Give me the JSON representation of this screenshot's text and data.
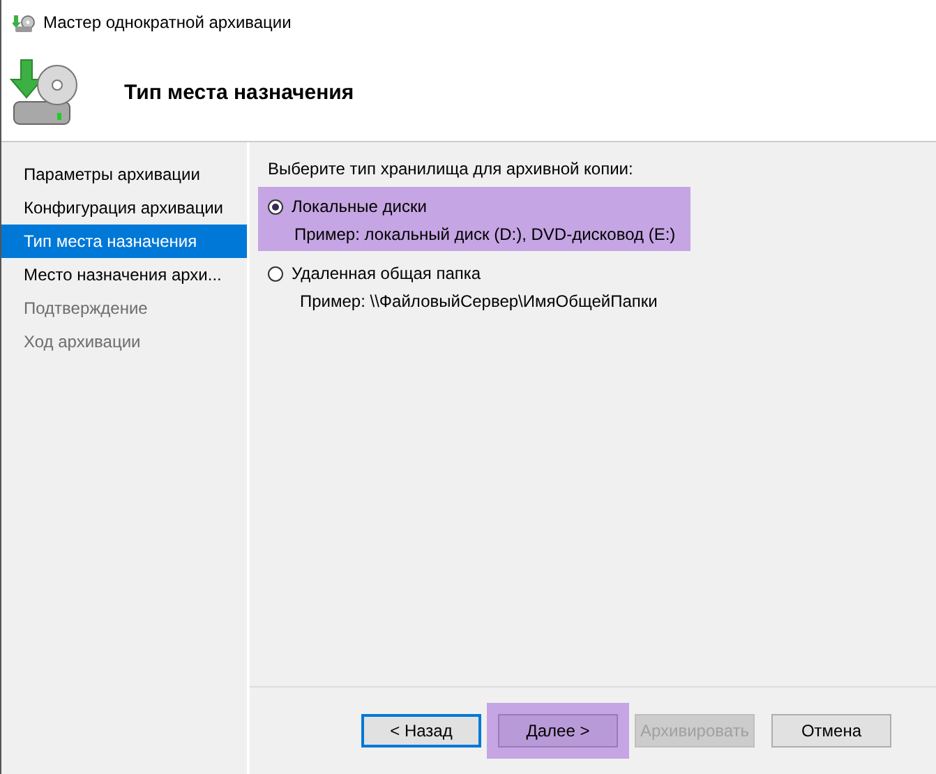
{
  "window": {
    "title": "Мастер однократной архивации"
  },
  "header": {
    "title": "Тип места назначения"
  },
  "sidebar": {
    "items": [
      {
        "label": "Параметры архивации",
        "selected": false,
        "disabled": false
      },
      {
        "label": "Конфигурация архивации",
        "selected": false,
        "disabled": false
      },
      {
        "label": "Тип места назначения",
        "selected": true,
        "disabled": false
      },
      {
        "label": "Место назначения архи...",
        "selected": false,
        "disabled": false
      },
      {
        "label": "Подтверждение",
        "selected": false,
        "disabled": true
      },
      {
        "label": "Ход архивации",
        "selected": false,
        "disabled": true
      }
    ]
  },
  "content": {
    "prompt": "Выберите тип хранилища для архивной копии:",
    "options": [
      {
        "label": "Локальные диски",
        "example": "Пример: локальный диск (D:), DVD-дисковод (E:)",
        "selected": true,
        "highlighted": true
      },
      {
        "label": "Удаленная общая папка",
        "example": "Пример: \\\\ФайловыйСервер\\ИмяОбщейПапки",
        "selected": false,
        "highlighted": false
      }
    ]
  },
  "buttons": [
    {
      "label": "< Назад",
      "focused": true,
      "disabled": false,
      "highlighted": false
    },
    {
      "label": "Далее >",
      "focused": false,
      "disabled": false,
      "highlighted": true
    },
    {
      "label": "Архивировать",
      "focused": false,
      "disabled": true,
      "highlighted": false
    },
    {
      "label": "Отмена",
      "focused": false,
      "disabled": false,
      "highlighted": false
    }
  ]
}
